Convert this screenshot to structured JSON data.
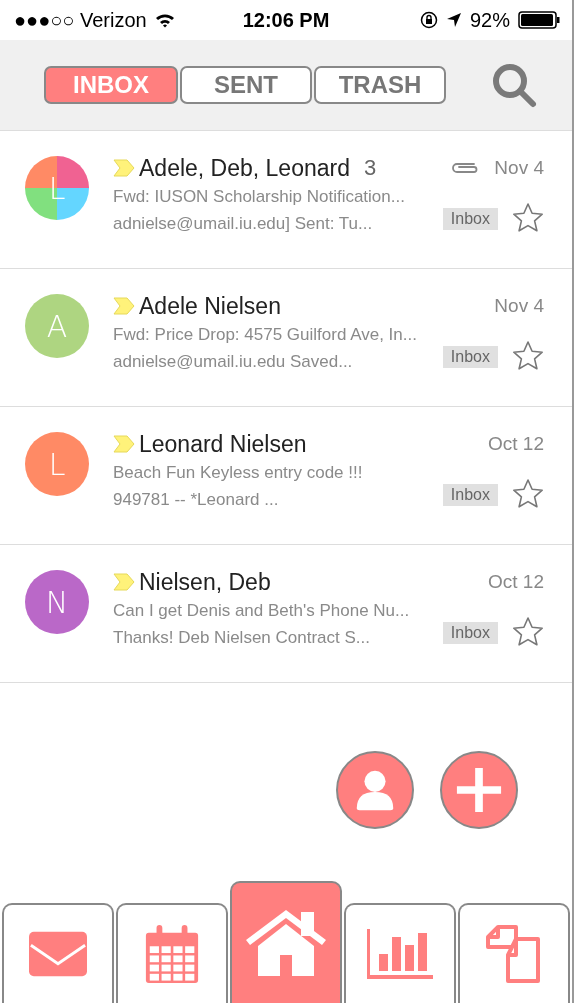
{
  "status_bar": {
    "carrier": "●●●○○ Verizon",
    "time": "12:06 PM",
    "battery": "92%"
  },
  "tabs": [
    {
      "label": "INBOX",
      "selected": true
    },
    {
      "label": "SENT",
      "selected": false
    },
    {
      "label": "TRASH",
      "selected": false
    }
  ],
  "messages": [
    {
      "avatar": {
        "letter": "L",
        "kind": "quadrants",
        "quadrants": [
          {
            "color": "#ff8a65"
          },
          {
            "color": "#f06292"
          },
          {
            "color": "#81e07f"
          },
          {
            "color": "#64d6ff"
          }
        ]
      },
      "important": true,
      "sender": "Adele, Deb, Leonard",
      "count": "3",
      "has_attachment": true,
      "date": "Nov 4",
      "preview": [
        "Fwd: IUSON Scholarship Notification...",
        "adnielse@umail.iu.edu] Sent: Tu..."
      ],
      "label": "Inbox",
      "starred": false
    },
    {
      "avatar": {
        "letter": "A",
        "kind": "solid",
        "color": "#aed581"
      },
      "important": true,
      "sender": "Adele Nielsen",
      "has_attachment": false,
      "date": "Nov 4",
      "preview": [
        "Fwd: Price Drop: 4575 Guilford Ave, In...",
        "adnielse@umail.iu.edu   Saved..."
      ],
      "label": "Inbox",
      "starred": false
    },
    {
      "avatar": {
        "letter": "L",
        "kind": "solid",
        "color": "#ff8a65"
      },
      "important": true,
      "sender": "Leonard Nielsen",
      "has_attachment": false,
      "date": "Oct 12",
      "preview": [
        "Beach Fun Keyless entry code !!!",
        "949781 -- *Leonard ..."
      ],
      "label": "Inbox",
      "starred": false
    },
    {
      "avatar": {
        "letter": "N",
        "kind": "solid",
        "color": "#ba68c8"
      },
      "important": true,
      "sender": "Nielsen, Deb",
      "has_attachment": false,
      "date": "Oct 12",
      "preview": [
        "Can I get Denis and Beth's Phone Nu...",
        "Thanks! Deb Nielsen Contract S..."
      ],
      "label": "Inbox",
      "starred": false
    }
  ],
  "fabs": [
    {
      "kind": "contact"
    },
    {
      "kind": "compose"
    }
  ],
  "nav": [
    {
      "kind": "mail",
      "selected": false
    },
    {
      "kind": "calendar",
      "selected": false
    },
    {
      "kind": "home",
      "selected": true
    },
    {
      "kind": "chart",
      "selected": false
    },
    {
      "kind": "documents",
      "selected": false
    }
  ]
}
